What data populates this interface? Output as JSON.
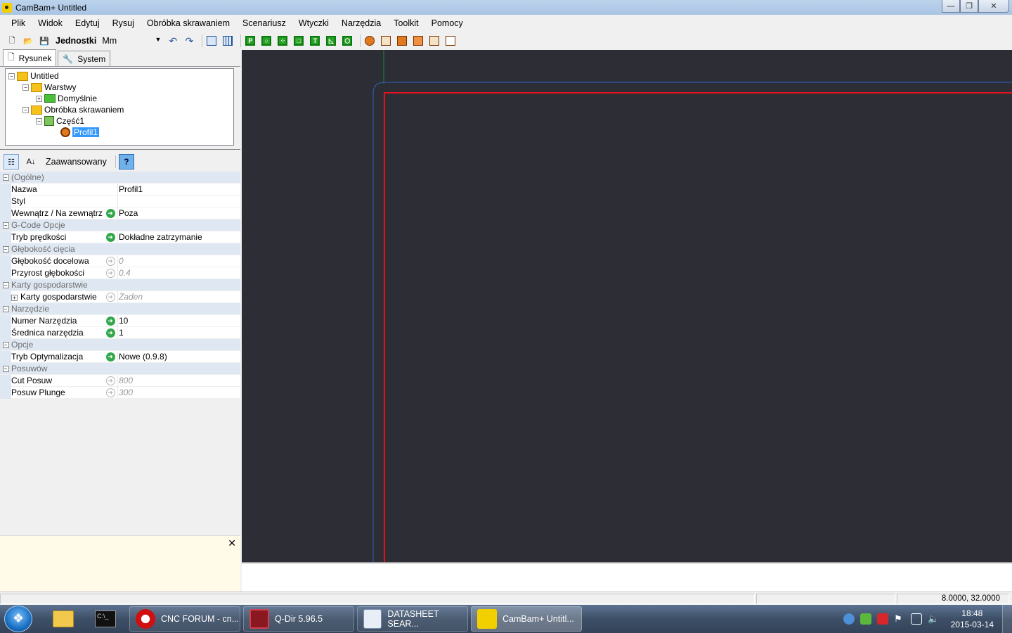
{
  "window": {
    "title": "CamBam+  Untitled"
  },
  "menu": [
    "Plik",
    "Widok",
    "Edytuj",
    "Rysuj",
    "Obróbka skrawaniem",
    "Scenariusz",
    "Wtyczki",
    "Narzędzia",
    "Toolkit",
    "Pomocy"
  ],
  "toolbar": {
    "units_label": "Jednostki",
    "units_value": "Mm"
  },
  "left_tabs": {
    "drawing": "Rysunek",
    "system": "System"
  },
  "tree": {
    "root": "Untitled",
    "layers": "Warstwy",
    "default_layer": "Domyślnie",
    "machining": "Obróbka skrawaniem",
    "part": "Część1",
    "profile": "Profil1"
  },
  "propbar": {
    "advanced": "Zaawansowany"
  },
  "properties": {
    "general": "(Ogólne)",
    "name_label": "Nazwa",
    "name_value": "Profil1",
    "style_label": "Styl",
    "style_value": "",
    "inout_label": "Wewnątrz / Na zewnątrz",
    "inout_value": "Poza",
    "gcode": "G-Code Opcje",
    "speed_label": "Tryb prędkości",
    "speed_value": "Dokładne zatrzymanie",
    "depth": "Głębokość cięcia",
    "target_depth_label": "Głębokość docelowa",
    "target_depth_value": "0",
    "depth_inc_label": "Przyrost głębokości",
    "depth_inc_value": "0.4",
    "tabs_cat": "Karty gospodarstwie",
    "tabs_label": "Karty gospodarstwie",
    "tabs_value": "Żaden",
    "tool": "Narzędzie",
    "tool_num_label": "Numer Narzędzia",
    "tool_num_value": "10",
    "tool_dia_label": "Średnica narzędzia",
    "tool_dia_value": "1",
    "options": "Opcje",
    "opt_label": "Tryb Optymalizacja",
    "opt_value": "Nowe (0.9.8)",
    "feeds": "Posuwów",
    "cut_feed_label": "Cut Posuw",
    "cut_feed_value": "800",
    "plunge_feed_label": "Posuw Plunge",
    "plunge_feed_value": "300"
  },
  "statusbar": {
    "coords": "8.0000, 32.0000"
  },
  "taskbar": {
    "tasks": [
      "CNC FORUM - cn...",
      "Q-Dir 5.96.5",
      "DATASHEET SEAR...",
      "CamBam+  Untitl..."
    ],
    "time": "18:48",
    "date": "2015-03-14"
  },
  "colors": {
    "canvas_bg": "#2d2e35",
    "profile_line": "#e0141e",
    "stock_line": "#2f5fbf",
    "axis_y": "#1c8a2e"
  }
}
